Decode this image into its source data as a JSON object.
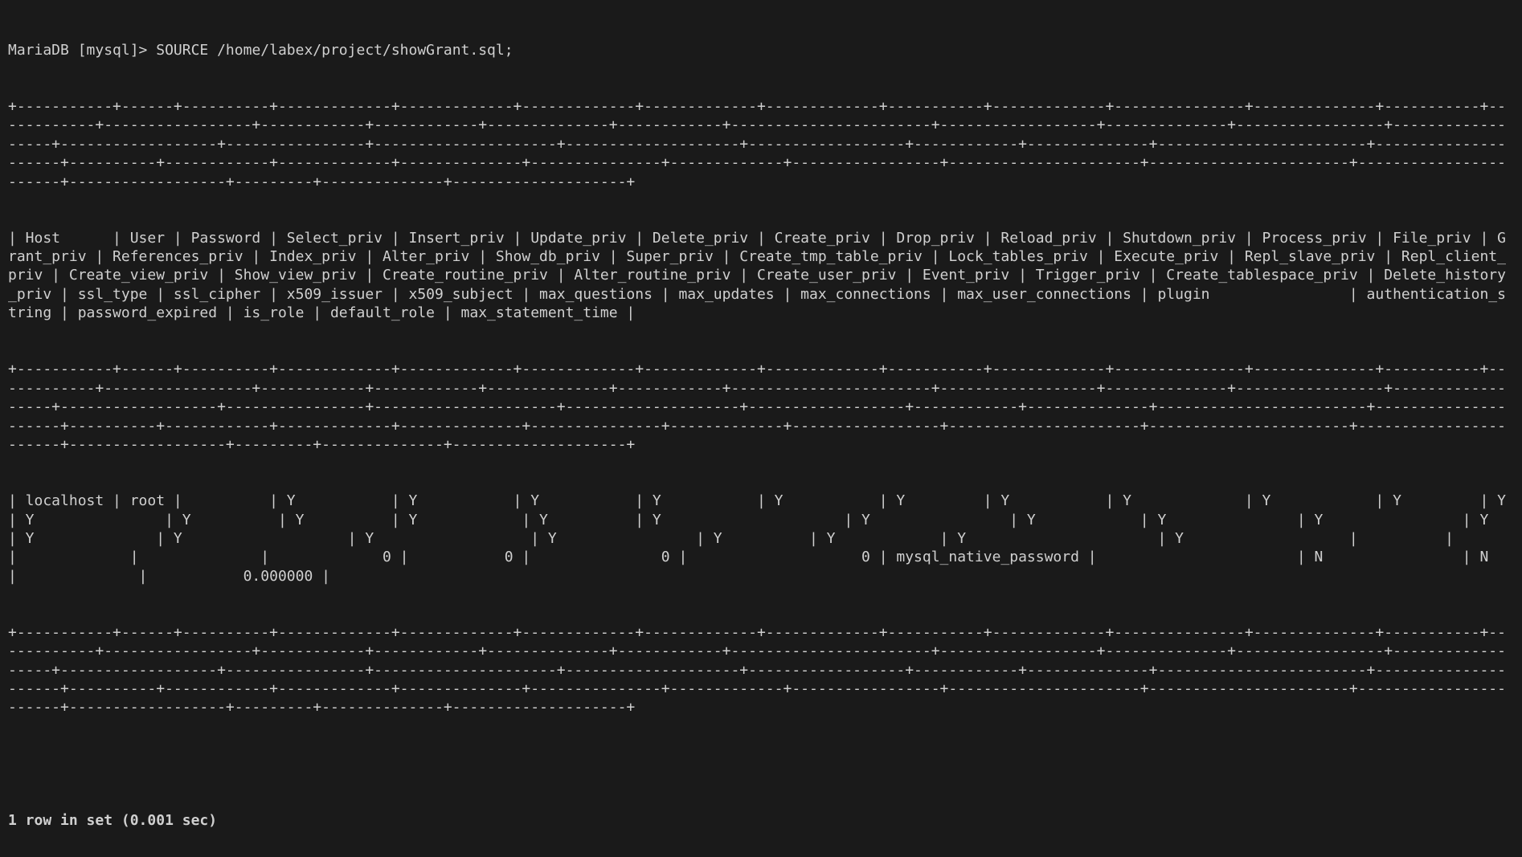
{
  "prompt": "MariaDB [mysql]> ",
  "command": "SOURCE /home/labex/project/showGrant.sql;",
  "sep_line": "+-----------+------+----------+-------------+-------------+-------------+-------------+-------------+-----------+-------------+---------------+--------------+-----------+------------+-----------------+------------+------------+--------------+------------+-----------------------+------------------+--------------+-----------------+------------------+------------------+----------------+---------------------+--------------------+------------------+------------+--------------+------------------------+---------------------+----------+------------+-------------+--------------+---------------+-------------+-----------------+----------------------+-----------------------+-----------------------+------------------+---------+--------------+--------------------+",
  "header_row": "| Host      | User | Password | Select_priv | Insert_priv | Update_priv | Delete_priv | Create_priv | Drop_priv | Reload_priv | Shutdown_priv | Process_priv | File_priv | Grant_priv | References_priv | Index_priv | Alter_priv | Show_db_priv | Super_priv | Create_tmp_table_priv | Lock_tables_priv | Execute_priv | Repl_slave_priv | Repl_client_priv | Create_view_priv | Show_view_priv | Create_routine_priv | Alter_routine_priv | Create_user_priv | Event_priv | Trigger_priv | Create_tablespace_priv | Delete_history_priv | ssl_type | ssl_cipher | x509_issuer | x509_subject | max_questions | max_updates | max_connections | max_user_connections | plugin                | authentication_string | password_expired | is_role | default_role | max_statement_time |",
  "data_row": "| localhost | root |          | Y           | Y           | Y           | Y           | Y           | Y         | Y           | Y             | Y            | Y         | Y          | Y               | Y          | Y          | Y            | Y          | Y                     | Y                | Y            | Y               | Y                | Y                | Y              | Y                   | Y                  | Y                | Y          | Y            | Y                      | Y                   |          |            |             |              |             0 |           0 |               0 |                    0 | mysql_native_password |                       | N                | N       |              |           0.000000 |",
  "footer": "1 row in set (0.001 sec)",
  "chart_data": {
    "type": "table",
    "title": "mysql.user privileges (SHOW GRANTS style query)",
    "columns": [
      "Host",
      "User",
      "Password",
      "Select_priv",
      "Insert_priv",
      "Update_priv",
      "Delete_priv",
      "Create_priv",
      "Drop_priv",
      "Reload_priv",
      "Shutdown_priv",
      "Process_priv",
      "File_priv",
      "Grant_priv",
      "References_priv",
      "Index_priv",
      "Alter_priv",
      "Show_db_priv",
      "Super_priv",
      "Create_tmp_table_priv",
      "Lock_tables_priv",
      "Execute_priv",
      "Repl_slave_priv",
      "Repl_client_priv",
      "Create_view_priv",
      "Show_view_priv",
      "Create_routine_priv",
      "Alter_routine_priv",
      "Create_user_priv",
      "Event_priv",
      "Trigger_priv",
      "Create_tablespace_priv",
      "Delete_history_priv",
      "ssl_type",
      "ssl_cipher",
      "x509_issuer",
      "x509_subject",
      "max_questions",
      "max_updates",
      "max_connections",
      "max_user_connections",
      "plugin",
      "authentication_string",
      "password_expired",
      "is_role",
      "default_role",
      "max_statement_time"
    ],
    "rows": [
      [
        "localhost",
        "root",
        "",
        "Y",
        "Y",
        "Y",
        "Y",
        "Y",
        "Y",
        "Y",
        "Y",
        "Y",
        "Y",
        "Y",
        "Y",
        "Y",
        "Y",
        "Y",
        "Y",
        "Y",
        "Y",
        "Y",
        "Y",
        "Y",
        "Y",
        "Y",
        "Y",
        "Y",
        "Y",
        "Y",
        "Y",
        "Y",
        "Y",
        "",
        "",
        "",
        "",
        0,
        0,
        0,
        0,
        "mysql_native_password",
        "",
        "N",
        "N",
        "",
        0.0
      ]
    ],
    "row_count": 1,
    "elapsed_sec": 0.001
  }
}
